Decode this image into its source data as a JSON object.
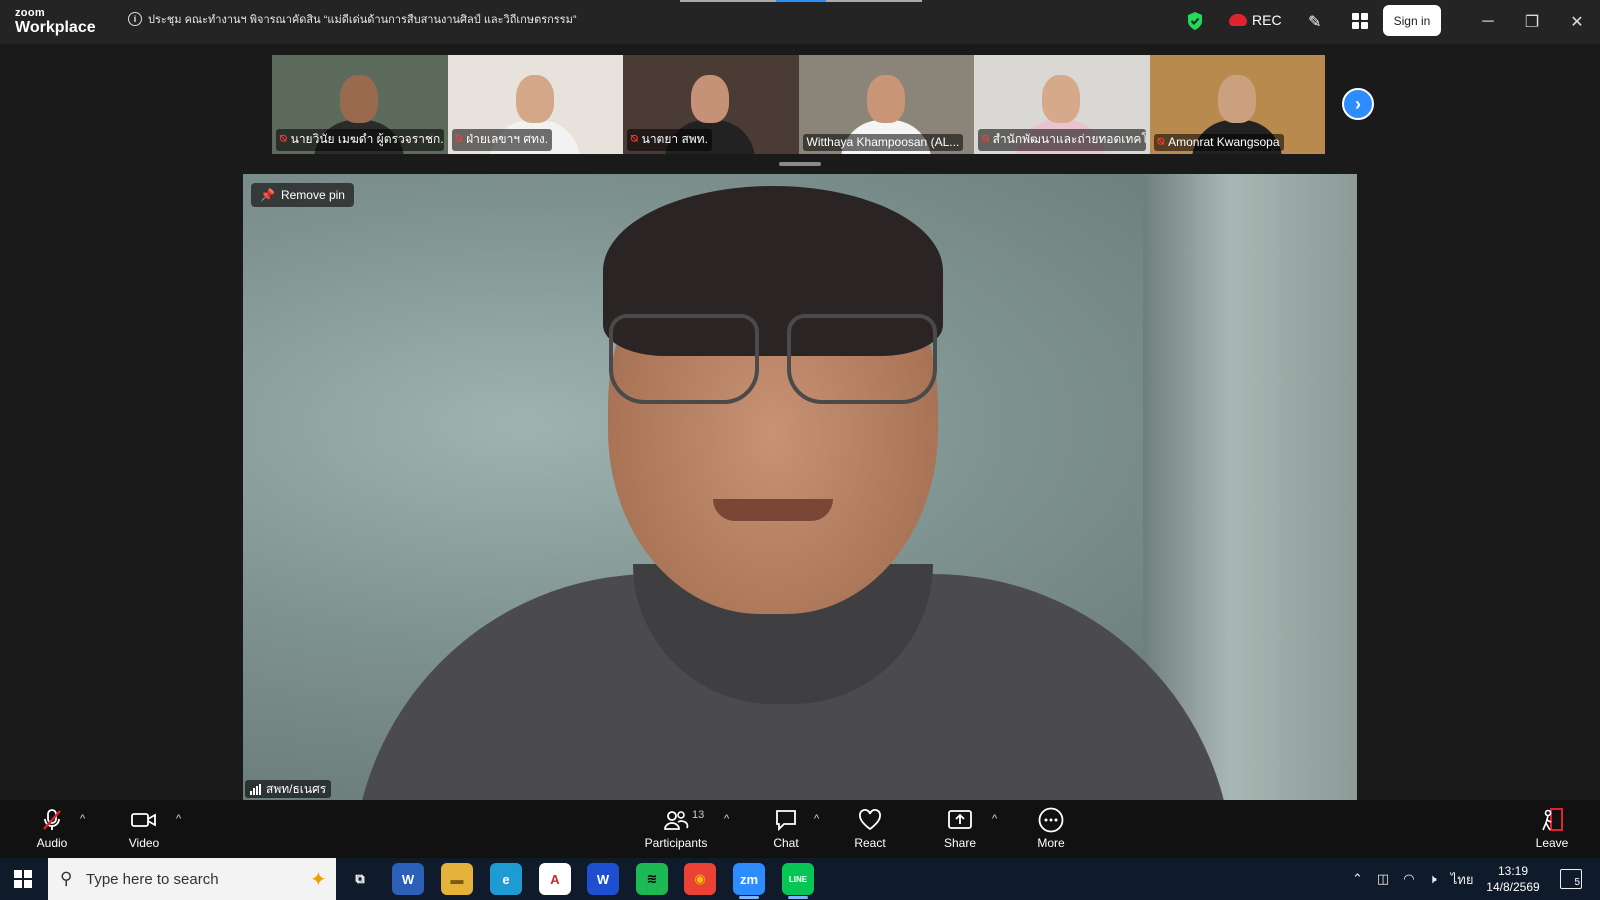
{
  "app": {
    "brand_top": "zoom",
    "brand_bottom": "Workplace",
    "meeting_title": "ประชุม คณะทำงานฯ พิจารณาคัดสิน “แม่ดีเด่นด้านการสืบสานงานศิลป์ และวิถีเกษตรกรรม”",
    "info_icon": "i",
    "rec_label": "REC",
    "signin_label": "Sign in",
    "minimize": "─",
    "restore": "❐",
    "close": "✕"
  },
  "gallery": {
    "participants": [
      {
        "name": "นายวินัย เมฆดำ ผู้ตรวจราชก...",
        "muted": true,
        "active": false,
        "bg": "#5d6b5c",
        "skin": "#9a6a4f",
        "shirt": "#2b2b2b"
      },
      {
        "name": "ฝ่ายเลขาฯ ศทง.",
        "muted": true,
        "active": false,
        "bg": "#e7e3dc",
        "skin": "#d4a788",
        "shirt": "#f2f2f2"
      },
      {
        "name": "นาตยา สพท.",
        "muted": true,
        "active": false,
        "bg": "#4a3b35",
        "skin": "#c69277",
        "shirt": "#222222"
      },
      {
        "name": "Witthaya Khampoosan (AL...",
        "muted": false,
        "active": true,
        "bg": "#8b8478",
        "skin": "#c89576",
        "shirt": "#f5f5f5"
      },
      {
        "name": "สำนักพัฒนาและถ่ายทอดเทคโ...",
        "muted": true,
        "active": false,
        "bg": "#d9d8d5",
        "skin": "#d6a98a",
        "shirt": "#e9c3cf"
      },
      {
        "name": "Amonrat Kwangsopa",
        "muted": true,
        "active": false,
        "bg": "#b98a4e",
        "skin": "#caa07e",
        "shirt": "#222222"
      }
    ],
    "next_arrow": "›"
  },
  "main": {
    "remove_pin_label": "Remove pin",
    "speaker_name": "สพท/ธเนศร"
  },
  "toolbar": {
    "audio": "Audio",
    "video": "Video",
    "participants": "Participants",
    "participants_count": "13",
    "chat": "Chat",
    "react": "React",
    "share": "Share",
    "more": "More",
    "leave": "Leave",
    "caret": "^"
  },
  "taskbar": {
    "search_placeholder": "Type here to search",
    "apps": [
      {
        "name": "taskview",
        "label": "⧉",
        "bg": "transparent",
        "color": "#ffffff"
      },
      {
        "name": "word",
        "label": "W",
        "bg": "#2b5fb8",
        "color": "#ffffff"
      },
      {
        "name": "explorer",
        "label": "▬",
        "bg": "#e6b33a",
        "color": "#7a5a10"
      },
      {
        "name": "edge",
        "label": "e",
        "bg": "#1f9bd3",
        "color": "#ffffff"
      },
      {
        "name": "acrobat",
        "label": "A",
        "bg": "#ffffff",
        "color": "#d1232a"
      },
      {
        "name": "wondershare",
        "label": "W",
        "bg": "#1e4fd1",
        "color": "#ffffff"
      },
      {
        "name": "spotify",
        "label": "≋",
        "bg": "#1db954",
        "color": "#000000"
      },
      {
        "name": "chrome",
        "label": "◉",
        "bg": "#ea4335",
        "color": "#fbbc05"
      },
      {
        "name": "zoom",
        "label": "zm",
        "bg": "#2d8cff",
        "color": "#ffffff"
      },
      {
        "name": "line",
        "label": "LINE",
        "bg": "#06c755",
        "color": "#ffffff"
      }
    ],
    "tray_lang": "ไทย",
    "time": "13:19",
    "date": "14/8/2569",
    "notifications": "5"
  }
}
